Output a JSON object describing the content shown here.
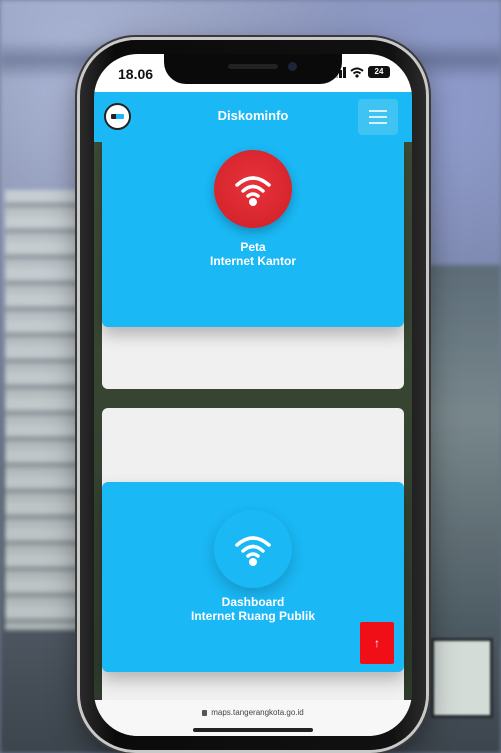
{
  "status_bar": {
    "time": "18.06",
    "battery_level": "24"
  },
  "header": {
    "title": "Diskominfo",
    "logo_icon": "city-logo-icon",
    "menu_icon": "hamburger-menu-icon"
  },
  "cards": [
    {
      "line1": "Peta",
      "line2": "Internet Kantor",
      "icon": "wifi-icon",
      "icon_color": "#d9262e"
    },
    {
      "line1": "Dashboard",
      "line2": "Internet Ruang Publik",
      "icon": "wifi-icon",
      "icon_color": "#1ab8f5"
    }
  ],
  "scroll_top": {
    "label": "↑",
    "color": "#f00f16"
  },
  "address_bar": {
    "url": "maps.tangerangkota.go.id"
  },
  "colors": {
    "accent": "#1ab8f5",
    "card_background": "#f0f0f0"
  }
}
